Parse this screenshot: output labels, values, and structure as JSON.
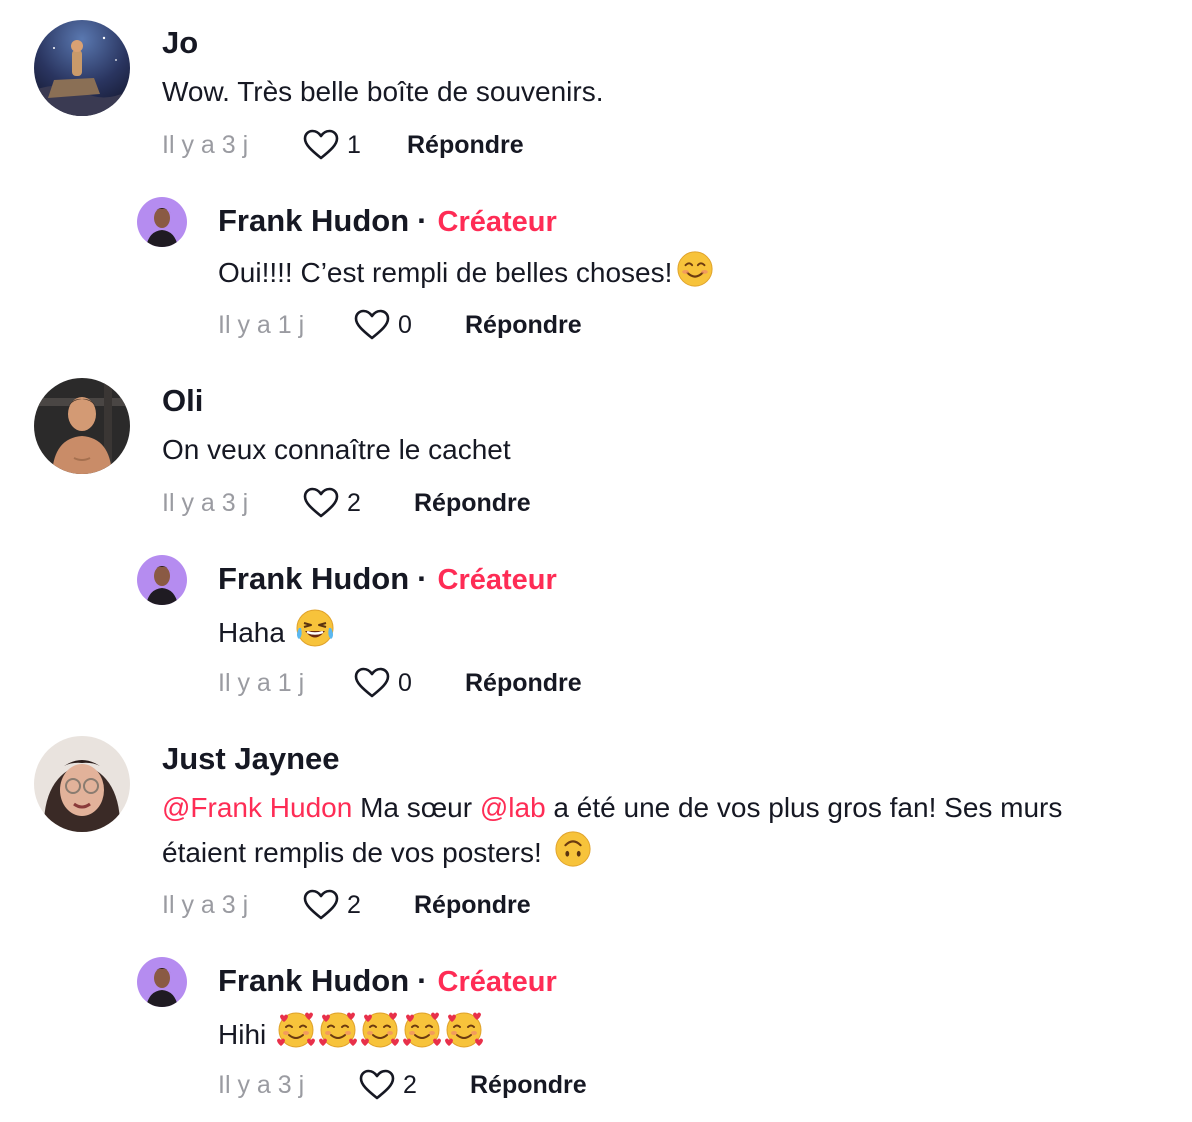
{
  "comments": [
    {
      "author": "Jo",
      "text": "Wow. Très belle boîte de souvenirs.",
      "time": "Il y a 3 j",
      "likes": "1",
      "reply_label": "Répondre"
    },
    {
      "author": "Frank Hudon",
      "badge_separator": "·",
      "badge": "Créateur",
      "text": "Oui!!!! C’est rempli de belles choses!",
      "time": "Il y a 1 j",
      "likes": "0",
      "reply_label": "Répondre"
    },
    {
      "author": "Oli",
      "text": "On veux connaître le cachet",
      "time": "Il y a 3 j",
      "likes": "2",
      "reply_label": "Répondre"
    },
    {
      "author": "Frank Hudon",
      "badge_separator": "·",
      "badge": "Créateur",
      "text": "Haha",
      "time": "Il y a 1 j",
      "likes": "0",
      "reply_label": "Répondre"
    },
    {
      "author": "Just Jaynee",
      "mention_1": "@Frank Hudon",
      "text_1": " Ma sœur ",
      "mention_2": "@lab",
      "text_2": " a été une de vos plus gros fan! Ses murs",
      "text_line2": "étaient remplis de vos posters!",
      "time": "Il y a 3 j",
      "likes": "2",
      "reply_label": "Répondre"
    },
    {
      "author": "Frank Hudon",
      "badge_separator": "·",
      "badge": "Créateur",
      "text": "Hihi",
      "time": "Il y a 3 j",
      "likes": "2",
      "reply_label": "Répondre"
    }
  ],
  "icons": {
    "like": "heart-outline-icon",
    "emoji_1": "smiling-face-emoji",
    "emoji_2": "tears-of-joy-emoji",
    "emoji_3": "upside-down-face-emoji",
    "emoji_4": "smiling-face-with-hearts-emoji"
  },
  "colors": {
    "accent": "#fe2c55",
    "text": "#161823",
    "muted": "#9a9ba1"
  }
}
